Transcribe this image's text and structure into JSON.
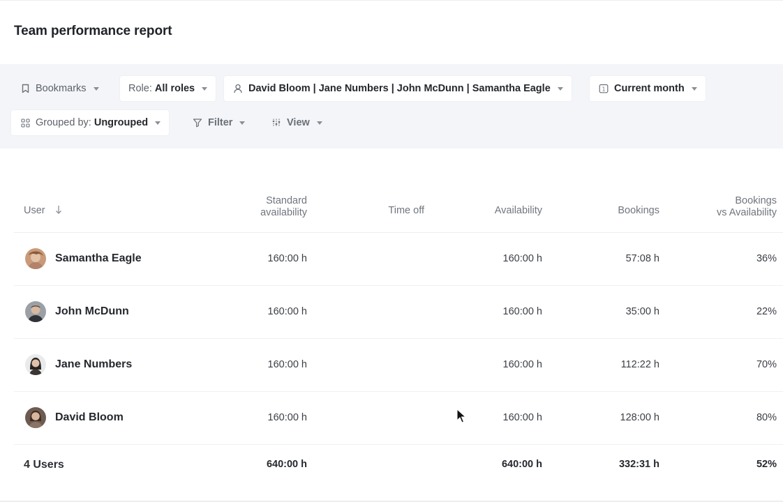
{
  "page": {
    "title": "Team performance report"
  },
  "filters": {
    "bookmarks": "Bookmarks",
    "role_prefix": "Role:",
    "role_value": "All roles",
    "people": "David Bloom | Jane Numbers | John McDunn | Samantha Eagle",
    "period": "Current month",
    "group_prefix": "Grouped by:",
    "group_value": "Ungrouped",
    "filter": "Filter",
    "view": "View"
  },
  "table": {
    "columns": {
      "user": "User",
      "standard_1": "Standard",
      "standard_2": "availability",
      "time_off": "Time off",
      "availability": "Availability",
      "bookings": "Bookings",
      "bva_1": "Bookings",
      "bva_2": "vs Availability"
    },
    "rows": [
      {
        "name": "Samantha Eagle",
        "standard": "160:00 h",
        "time_off": "",
        "availability": "160:00 h",
        "bookings": "57:08 h",
        "bva": "36%"
      },
      {
        "name": "John McDunn",
        "standard": "160:00 h",
        "time_off": "",
        "availability": "160:00 h",
        "bookings": "35:00 h",
        "bva": "22%"
      },
      {
        "name": "Jane Numbers",
        "standard": "160:00 h",
        "time_off": "",
        "availability": "160:00 h",
        "bookings": "112:22 h",
        "bva": "70%"
      },
      {
        "name": "David Bloom",
        "standard": "160:00 h",
        "time_off": "",
        "availability": "160:00 h",
        "bookings": "128:00 h",
        "bva": "80%"
      }
    ],
    "totals": {
      "label": "4 Users",
      "standard": "640:00 h",
      "availability": "640:00 h",
      "bookings": "332:31 h",
      "bva": "52%"
    }
  },
  "icons": {
    "bookmark": "bookmark-icon",
    "person": "person-icon",
    "calendar": "calendar-icon",
    "grid": "grid-icon",
    "filter": "funnel-icon",
    "view": "sliders-icon",
    "sort": "arrow-down-icon"
  },
  "colors": {
    "toolbar_bg": "#f3f5f8",
    "text_dark": "#25282d",
    "text_muted": "#70757d"
  }
}
